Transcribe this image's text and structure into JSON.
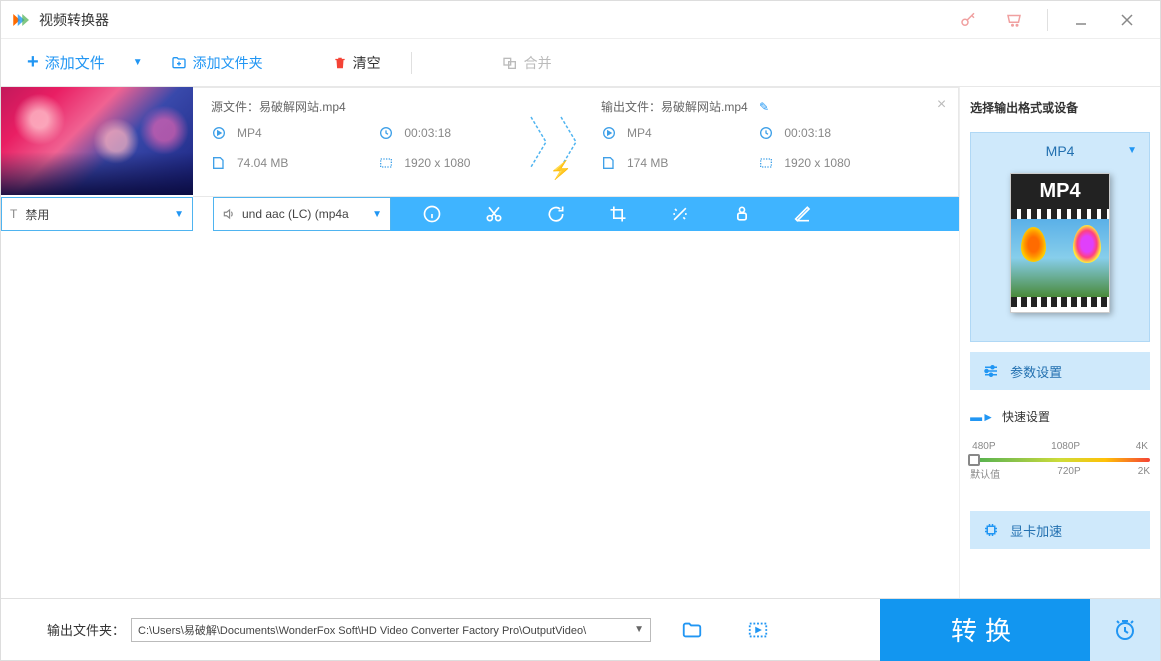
{
  "title": "视频转换器",
  "toolbar": {
    "add_file": "添加文件",
    "add_folder": "添加文件夹",
    "clear": "清空",
    "merge": "合并"
  },
  "file": {
    "source_label": "源文件：",
    "source_name": "易破解网站.mp4",
    "output_label": "输出文件：",
    "output_name": "易破解网站.mp4",
    "src_format": "MP4",
    "src_duration": "00:03:18",
    "src_size": "74.04 MB",
    "src_resolution": "1920 x 1080",
    "out_format": "MP4",
    "out_duration": "00:03:18",
    "out_size": "174 MB",
    "out_resolution": "1920 x 1080"
  },
  "selects": {
    "subtitle": "禁用",
    "audio": "und aac (LC) (mp4a"
  },
  "sidebar": {
    "title": "选择输出格式或设备",
    "format": "MP4",
    "params": "参数设置",
    "quick": "快速设置",
    "gpu": "显卡加速",
    "slider_top": [
      "480P",
      "1080P",
      "4K"
    ],
    "slider_bottom": [
      "默认值",
      "720P",
      "2K"
    ]
  },
  "bottom": {
    "out_label": "输出文件夹：",
    "out_path": "C:\\Users\\易破解\\Documents\\WonderFox Soft\\HD Video Converter Factory Pro\\OutputVideo\\",
    "convert": "转换"
  }
}
